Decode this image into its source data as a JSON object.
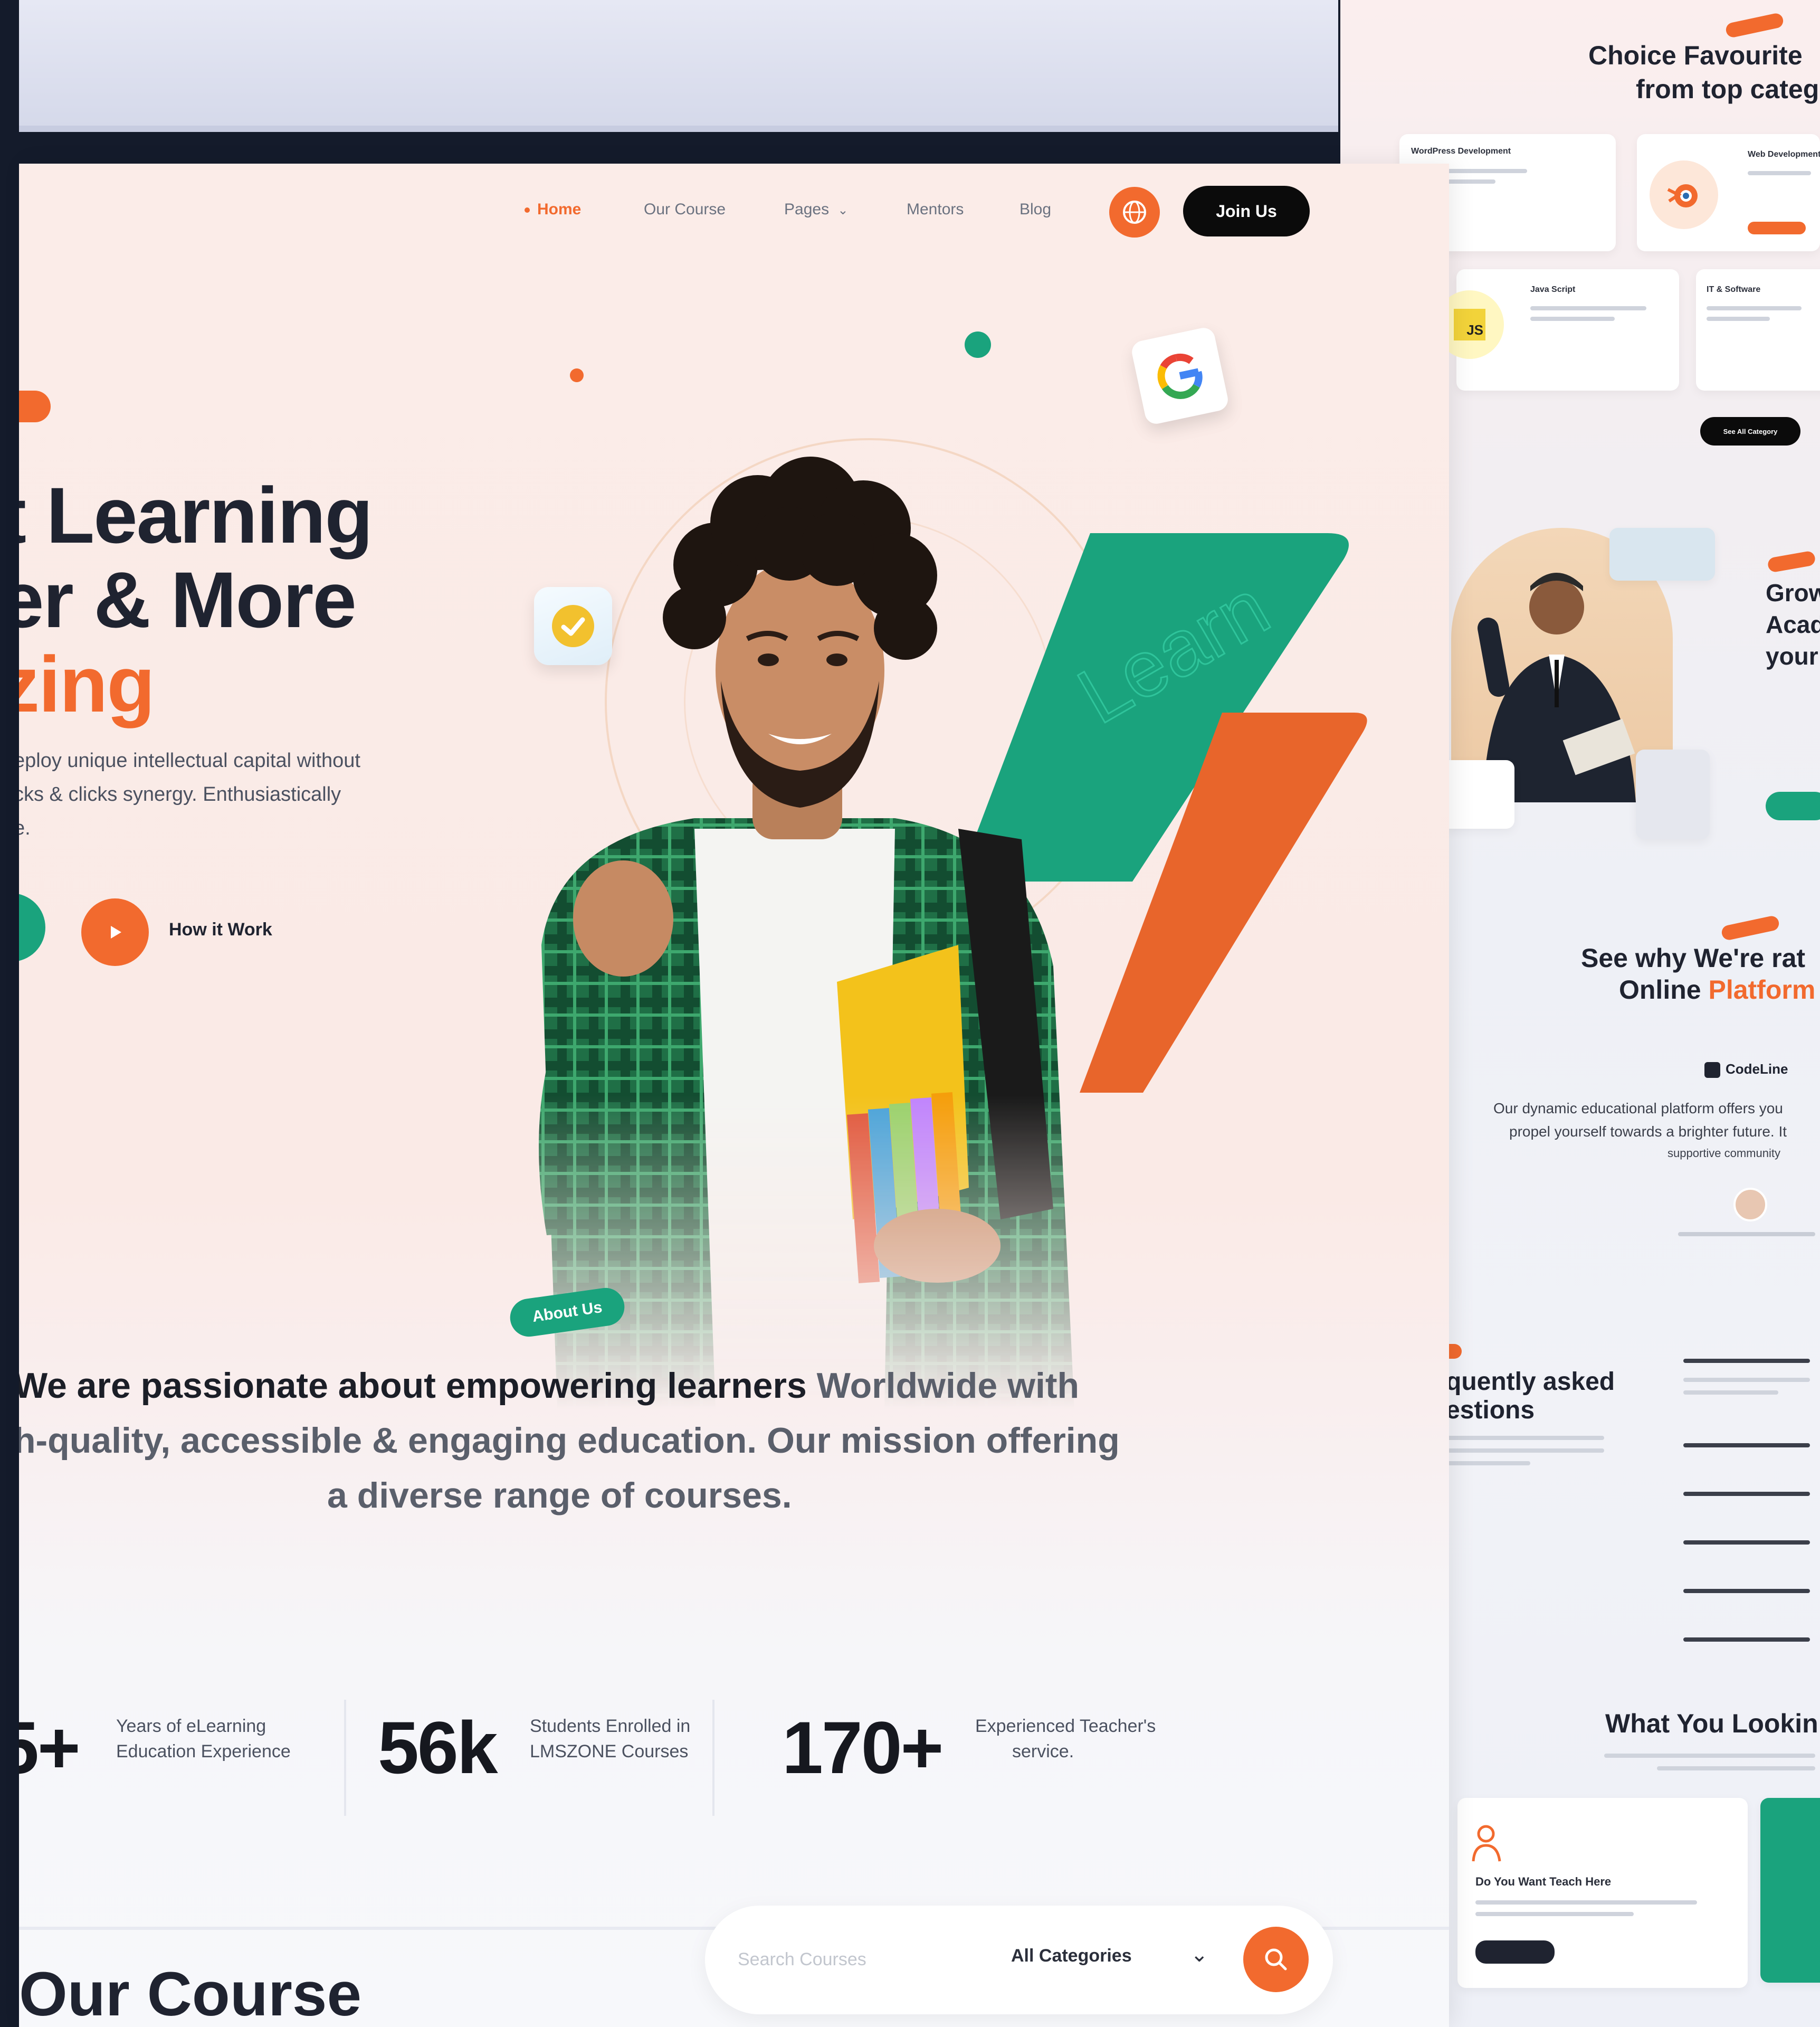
{
  "nav": {
    "items": [
      "Home",
      "Our Course",
      "Pages",
      "Mentors",
      "Blog"
    ],
    "pages_chevron": "⌄",
    "join_label": "Join Us"
  },
  "hero": {
    "line1": "t Learning",
    "line2": "er & More",
    "line3": "zing",
    "para": [
      "eploy unique intellectual capital without",
      "cks & clicks synergy. Enthusiastically",
      "e."
    ],
    "play_label": "How it Work",
    "art_text": "Learn"
  },
  "about": {
    "badge": "About Us",
    "line1_bold": "We are passionate about empowering learners",
    "line1_rest": " Worldwide with",
    "line2": "h-quality, accessible & engaging education. Our mission offering",
    "line3": "a diverse range of courses."
  },
  "stats": [
    {
      "value": "5+",
      "label1": "Years of eLearning",
      "label2": "Education Experience"
    },
    {
      "value": "56k",
      "label1": "Students Enrolled in",
      "label2": "LMSZONE Courses"
    },
    {
      "value": "170+",
      "label1": "Experienced Teacher's",
      "label2": "service."
    }
  ],
  "search": {
    "placeholder": "Search Courses",
    "category": "All Categories"
  },
  "courses_heading": "Our Course",
  "right_page": {
    "cat_title_1": "Choice Favourite",
    "cat_title_2": "from top categ",
    "cards": [
      "WordPress Development",
      "Web Development",
      "Java Script",
      "IT & Software"
    ],
    "js_badge": "JS",
    "all_category": "See All Category",
    "grow_lines": [
      "Grow",
      "Acad",
      "your"
    ],
    "review_title_1": "See why We're rat",
    "review_title_2a": "Online ",
    "review_title_2b": "Platform",
    "brand": "CodeLine",
    "review_lines": [
      "Our dynamic educational platform offers you",
      "propel yourself towards a brighter future. It",
      "supportive community"
    ],
    "faq_title_1": "quently asked",
    "faq_title_2": "estions",
    "looking_title": "What You Lookin",
    "teach_title": "Do You Want Teach Here"
  },
  "colors": {
    "accent": "#f26a2e",
    "green": "#1aa37d",
    "dark": "#1f2330"
  }
}
